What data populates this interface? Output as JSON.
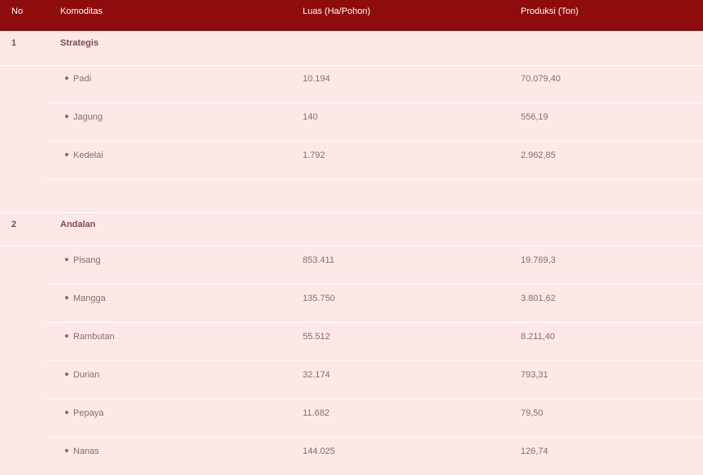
{
  "header": {
    "no": "No",
    "komoditas": "Komoditas",
    "luas": "Luas (Ha/Pohon)",
    "produksi": "Produksi (Ton)"
  },
  "sections": [
    {
      "no": "1",
      "name": "Strategis",
      "items": [
        {
          "name": "Padi",
          "luas": "10.194",
          "produksi": "70.079,40"
        },
        {
          "name": "Jagung",
          "luas": "140",
          "produksi": "556,19"
        },
        {
          "name": "Kedelai",
          "luas": "1.792",
          "produksi": "2.962,85"
        }
      ]
    },
    {
      "no": "2",
      "name": "Andalan",
      "items": [
        {
          "name": "Pisang",
          "luas": "853.411",
          "produksi": "19.769,3"
        },
        {
          "name": "Mangga",
          "luas": "135.750",
          "produksi": "3.801,62"
        },
        {
          "name": "Rambutan",
          "luas": "55.512",
          "produksi": "8.211,40"
        },
        {
          "name": "Durian",
          "luas": "32.174",
          "produksi": "793,31"
        },
        {
          "name": "Pepaya",
          "luas": "11.682",
          "produksi": "79,50"
        },
        {
          "name": "Nanas",
          "luas": "144.025",
          "produksi": "126,74"
        }
      ]
    }
  ],
  "colors": {
    "header_bg": "#8e0c0c",
    "row_bg": "#fde8e8",
    "divider": "#ffffff"
  }
}
